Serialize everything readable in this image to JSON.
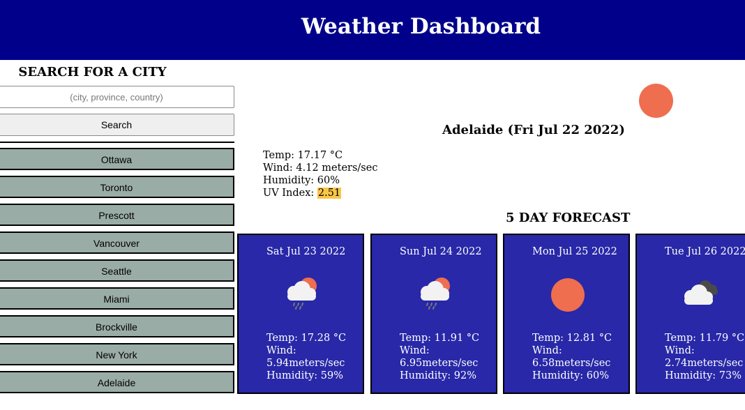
{
  "header": {
    "title": "Weather Dashboard"
  },
  "search": {
    "heading": "SEARCH FOR A CITY",
    "placeholder": "(city, province, country)",
    "value": "",
    "button_label": "Search"
  },
  "history": {
    "cities": [
      "Ottawa",
      "Toronto",
      "Prescott",
      "Vancouver",
      "Seattle",
      "Miami",
      "Brockville",
      "New York",
      "Adelaide"
    ]
  },
  "current": {
    "title": "Adelaide (Fri Jul 22 2022)",
    "icon": "sun-icon",
    "temp": "Temp: 17.17 °C",
    "wind": "Wind: 4.12 meters/sec",
    "humidity": "Humidity: 60%",
    "uv_label": "UV Index: ",
    "uv_value": "2.51",
    "uv_color": "#f9c646"
  },
  "forecast": {
    "heading": "5 DAY FORECAST",
    "days": [
      {
        "date": "Sat Jul 23 2022",
        "icon": "sun-cloud-rain-icon",
        "temp": "Temp: 17.28 °C",
        "wind_label": "Wind:",
        "wind_value": "5.94meters/sec",
        "humidity": "Humidity: 59%"
      },
      {
        "date": "Sun Jul 24 2022",
        "icon": "sun-cloud-rain-icon",
        "temp": "Temp: 11.91 °C",
        "wind_label": "Wind:",
        "wind_value": "6.95meters/sec",
        "humidity": "Humidity: 92%"
      },
      {
        "date": "Mon Jul 25 2022",
        "icon": "sun-icon",
        "temp": "Temp: 12.81 °C",
        "wind_label": "Wind:",
        "wind_value": "6.58meters/sec",
        "humidity": "Humidity: 60%"
      },
      {
        "date": "Tue Jul 26 2022",
        "icon": "cloudy-icon",
        "temp": "Temp: 11.79 °C",
        "wind_label": "Wind:",
        "wind_value": "2.74meters/sec",
        "humidity": "Humidity: 73%"
      }
    ]
  },
  "colors": {
    "header_bg": "#00008b",
    "card_bg": "#2828a8",
    "city_button_bg": "#9aaca6",
    "sun": "#ee6e4f"
  }
}
